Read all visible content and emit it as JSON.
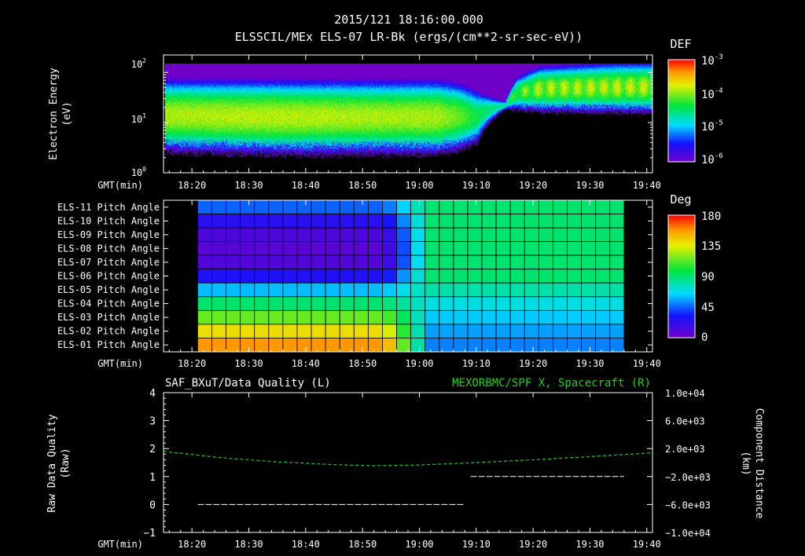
{
  "header": {
    "timestamp": "2015/121 18:16:00.000",
    "title": "ELSSCIL/MEx ELS-07 LR-Bk  (ergs/(cm**2-sr-sec-eV))"
  },
  "time_axis": {
    "label": "GMT(min)",
    "ticks": [
      "18:20",
      "18:30",
      "18:40",
      "18:50",
      "19:00",
      "19:10",
      "19:20",
      "19:30",
      "19:40"
    ]
  },
  "chart_data": [
    {
      "type": "heatmap",
      "title": "ELSSCIL/MEx ELS-07 LR-Bk  (ergs/(cm**2-sr-sec-eV))",
      "ylabel": "Electron Energy (eV)",
      "yscale": "log",
      "ylim": [
        1,
        150
      ],
      "xlim": [
        "18:15",
        "19:41"
      ],
      "y_ticks": [
        {
          "base": "10",
          "exp": "2"
        },
        {
          "base": "10",
          "exp": "1"
        },
        {
          "base": "10",
          "exp": "0"
        }
      ],
      "colorbar": {
        "label": "DEF",
        "ticks": [
          {
            "base": "10",
            "exp": "-3"
          },
          {
            "base": "10",
            "exp": "-4"
          },
          {
            "base": "10",
            "exp": "-5"
          },
          {
            "base": "10",
            "exp": "-6"
          }
        ],
        "range": [
          -6.3,
          -3
        ]
      },
      "band_profile": {
        "minutes": [
          -2,
          20,
          38,
          48,
          52,
          55,
          60,
          62,
          66,
          80,
          95,
          110
        ],
        "low_ev": [
          5,
          4.5,
          4.5,
          4.5,
          5,
          6,
          20,
          24,
          25,
          25,
          25,
          26
        ],
        "high_ev": [
          42,
          40,
          40,
          40,
          38,
          32,
          26,
          65,
          95,
          110,
          110,
          110
        ],
        "peak_log_def": [
          -4.0,
          -3.95,
          -4.0,
          -4.0,
          -4.2,
          -4.5,
          -4.8,
          -4.35,
          -4.1,
          -4.05,
          -4.05,
          -4.05
        ]
      }
    },
    {
      "type": "heatmap",
      "ylabel": "",
      "rows": [
        "ELS-11 Pitch Angle",
        "ELS-10 Pitch Angle",
        "ELS-09 Pitch Angle",
        "ELS-08 Pitch Angle",
        "ELS-07 Pitch Angle",
        "ELS-06 Pitch Angle",
        "ELS-05 Pitch Angle",
        "ELS-04 Pitch Angle",
        "ELS-03 Pitch Angle",
        "ELS-02 Pitch Angle",
        "ELS-01 Pitch Angle"
      ],
      "xlim": [
        "18:15",
        "19:41"
      ],
      "data_start": "18:21",
      "data_end": "19:36",
      "colorbar": {
        "label": "Deg",
        "ticks": [
          "180",
          "135",
          "90",
          "45",
          "0"
        ],
        "range": [
          0,
          180
        ]
      },
      "angles_before_1858": [
        45,
        25,
        12,
        8,
        10,
        28,
        60,
        90,
        115,
        140,
        158
      ],
      "angles_after_1900": [
        90,
        90,
        90,
        90,
        90,
        90,
        80,
        70,
        62,
        55,
        50
      ]
    },
    {
      "type": "line",
      "title_left": "SAF_BXuT/Data Quality (L)",
      "title_right": "MEXORBMC/SPF X, Spacecraft (R)",
      "ylabel_left": "Raw Data Quality (Raw)",
      "ylabel_right": "Component Distance (km)",
      "ylim_left": [
        -1,
        4
      ],
      "y_ticks_left": [
        "4",
        "3",
        "2",
        "1",
        "0",
        "−1"
      ],
      "ylim_right": [
        -10000,
        10000
      ],
      "y_ticks_right": [
        "1.0e+04",
        "6.0e+03",
        "2.0e+03",
        "−2.0e+03",
        "−6.0e+03",
        "−1.0e+04"
      ],
      "xlim": [
        "18:15",
        "19:41"
      ],
      "series": [
        {
          "name": "Data Quality",
          "axis": "left",
          "color": "#ffffff",
          "segments": [
            {
              "x": [
                "18:21",
                "19:08"
              ],
              "y": [
                0,
                0
              ]
            },
            {
              "x": [
                "19:09",
                "19:36"
              ],
              "y": [
                1,
                1
              ]
            }
          ]
        },
        {
          "name": "SPF X, Spacecraft",
          "axis": "right",
          "color": "#22cc22",
          "x": [
            "18:15",
            "18:25",
            "18:35",
            "18:45",
            "18:52",
            "19:00",
            "19:10",
            "19:20",
            "19:30",
            "19:41"
          ],
          "y": [
            1600,
            700,
            100,
            -300,
            -450,
            -350,
            0,
            400,
            850,
            1400
          ]
        }
      ]
    }
  ],
  "colors": {
    "text": "#ffffff",
    "background": "#000000",
    "spf_line": "#22cc22"
  }
}
